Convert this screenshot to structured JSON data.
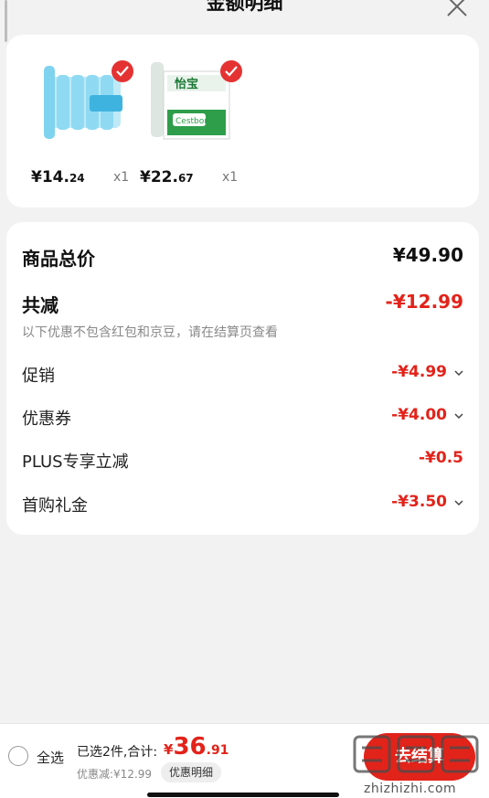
{
  "header": {
    "title": "金额明细"
  },
  "products": [
    {
      "price_int": "¥14.",
      "price_dec": "24",
      "qty": "x1",
      "thumb_color": "#7fd3ef"
    },
    {
      "price_int": "¥22.",
      "price_dec": "67",
      "qty": "x1",
      "thumb_color": "#2e9e4a"
    }
  ],
  "summary": {
    "total_label": "商品总价",
    "total_value": "¥49.90",
    "reduce_label": "共减",
    "reduce_value": "-¥12.99",
    "note": "以下优惠不包含红包和京豆，请在结算页查看",
    "items": [
      {
        "label": "促销",
        "value": "-¥4.99",
        "chevron": true
      },
      {
        "label": "优惠券",
        "value": "-¥4.00",
        "chevron": true
      },
      {
        "label": "PLUS专享立减",
        "value": "-¥0.5",
        "chevron": false
      },
      {
        "label": "首购礼金",
        "value": "-¥3.50",
        "chevron": true
      }
    ]
  },
  "bottom_bar": {
    "select_all": "全选",
    "selected_info": "已选2件,合计:",
    "total_symbol": "¥",
    "total_int": "36",
    "total_dec": ".91",
    "discount": "优惠减:¥12.99",
    "detail_button": "优惠明细",
    "checkout_button": "去结算",
    "watermark": "zhizhizhi.com"
  },
  "colors": {
    "accent": "#e2231a",
    "background": "#f2f2f2"
  }
}
